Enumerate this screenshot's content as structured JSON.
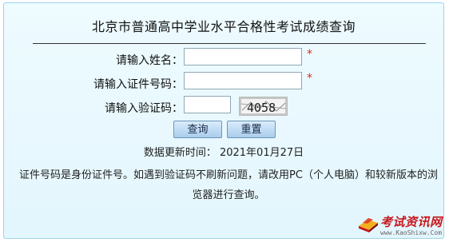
{
  "form": {
    "title": "北京市普通高中学业水平合格性考试成绩查询",
    "name_label": "请输入姓名：",
    "name_value": "",
    "id_label": "请输入证件号码：",
    "id_value": "",
    "captcha_label": "请输入验证码：",
    "captcha_value": "",
    "captcha_image_text": "4058",
    "required_mark": "*",
    "query_button": "查询",
    "reset_button": "重置"
  },
  "update_time": "数据更新时间：  2021年01月27日",
  "notice": "证件号码是身份证件号。如遇到验证码不刷新问题，请改用PC（个人电脑）和较新版本的浏览器进行查询。",
  "watermark": {
    "name": "考试资讯网",
    "url": "www.KaoShixw.Com",
    "icon": "book-logo-icon"
  },
  "colors": {
    "panel_bg": "#e3f6fd",
    "panel_border": "#9cd3e8",
    "required": "#e0281f",
    "brand": "#c8161d"
  }
}
